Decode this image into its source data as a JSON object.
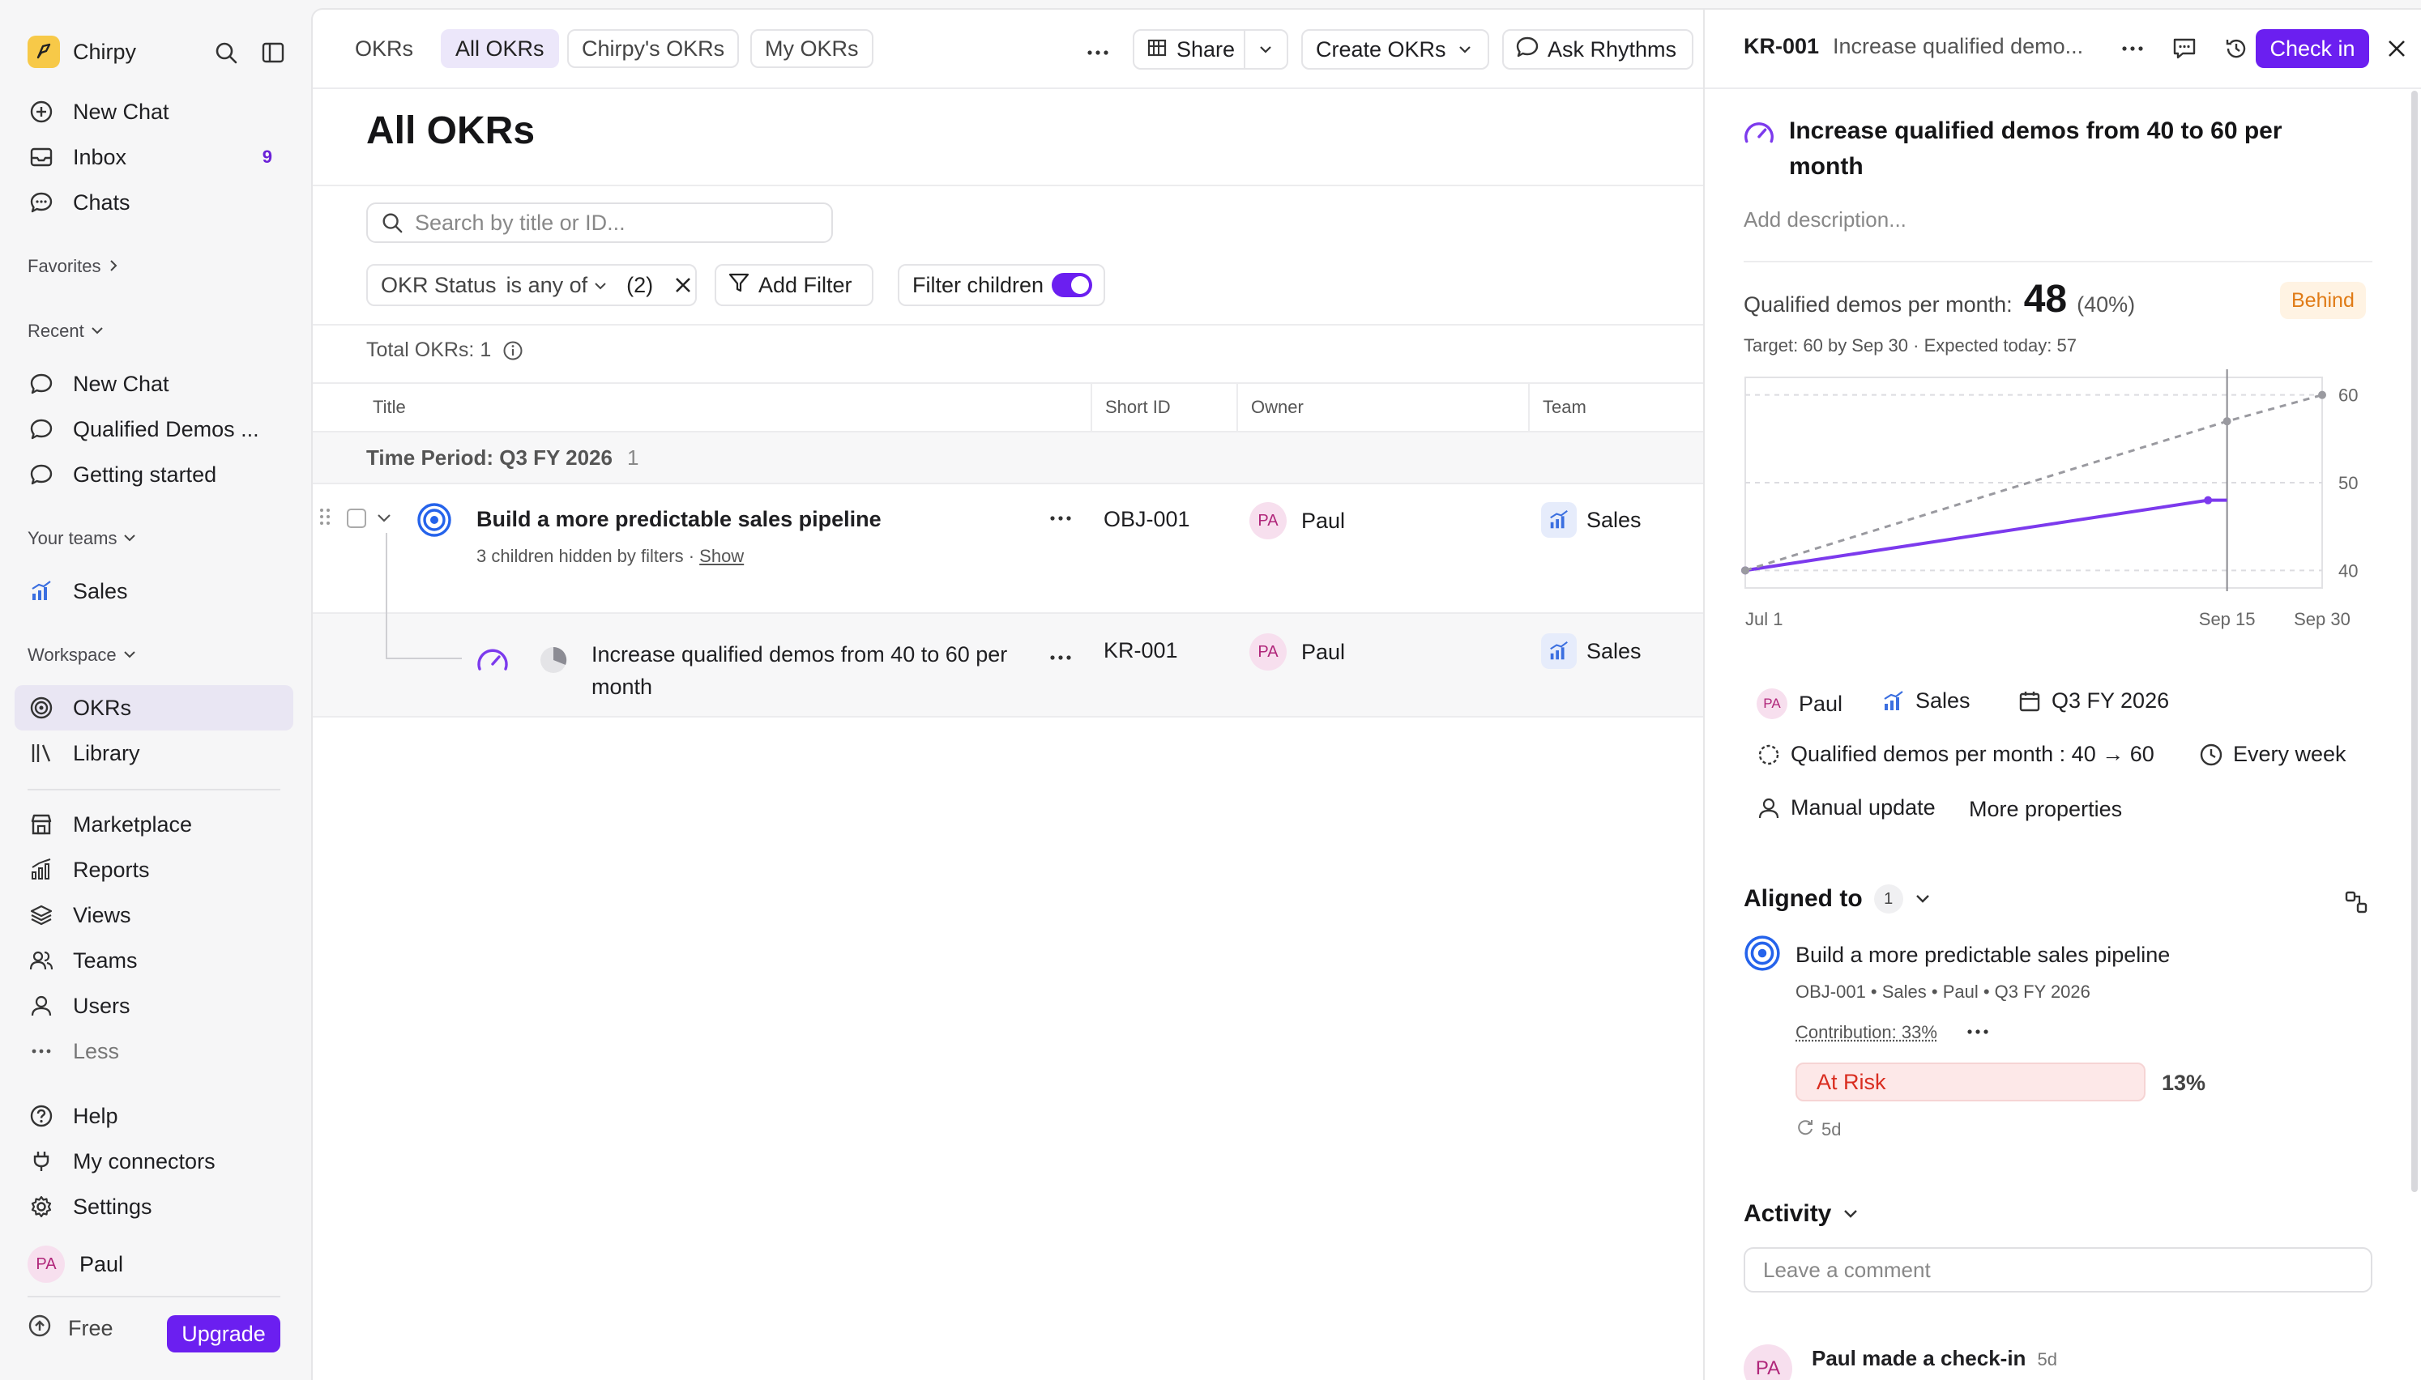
{
  "sidebar": {
    "brand": "Chirpy",
    "nav_top": [
      {
        "label": "New Chat",
        "icon": "plus-circle-icon"
      },
      {
        "label": "Inbox",
        "icon": "inbox-icon",
        "badge": "9"
      },
      {
        "label": "Chats",
        "icon": "chat-bubble-icon"
      }
    ],
    "favorites_label": "Favorites",
    "recent_label": "Recent",
    "recent": [
      {
        "label": "New Chat"
      },
      {
        "label": "Qualified Demos ..."
      },
      {
        "label": "Getting started"
      }
    ],
    "teams_label": "Your teams",
    "teams": [
      {
        "label": "Sales"
      }
    ],
    "workspace_label": "Workspace",
    "workspace": [
      {
        "label": "OKRs",
        "active": true
      },
      {
        "label": "Library"
      }
    ],
    "more": [
      {
        "label": "Marketplace"
      },
      {
        "label": "Reports"
      },
      {
        "label": "Views"
      },
      {
        "label": "Teams"
      },
      {
        "label": "Users"
      },
      {
        "label": "Less"
      }
    ],
    "bottom": [
      {
        "label": "Help"
      },
      {
        "label": "My connectors"
      },
      {
        "label": "Settings"
      }
    ],
    "user": {
      "initials": "PA",
      "name": "Paul"
    },
    "plan": "Free",
    "upgrade": "Upgrade"
  },
  "main": {
    "tabs": [
      "OKRs",
      "All OKRs",
      "Chirpy's OKRs",
      "My OKRs"
    ],
    "share": "Share",
    "create": "Create OKRs",
    "ask": "Ask Rhythms",
    "title": "All OKRs",
    "search_placeholder": "Search by title or ID...",
    "filter": {
      "field": "OKR Status",
      "op": "is any of",
      "count": "(2)"
    },
    "add_filter": "Add Filter",
    "filter_children": "Filter children",
    "total": "Total OKRs: 1",
    "columns": [
      "Title",
      "Short ID",
      "Owner",
      "Team"
    ],
    "group": {
      "label": "Time Period: Q3 FY 2026",
      "count": "1"
    },
    "rows": [
      {
        "title": "Build a more predictable sales pipeline",
        "sub": "3 children hidden by filters",
        "sub_link": "Show",
        "id": "OBJ-001",
        "owner_initials": "PA",
        "owner": "Paul",
        "team": "Sales"
      },
      {
        "title": "Increase qualified demos from 40 to 60 per month",
        "id": "KR-001",
        "owner_initials": "PA",
        "owner": "Paul",
        "team": "Sales"
      }
    ]
  },
  "panel": {
    "key": "KR-001",
    "header_title": "Increase qualified demo...",
    "checkin": "Check in",
    "title": "Increase qualified demos from 40 to 60 per month",
    "add_description": "Add description...",
    "metric_label": "Qualified demos per month:",
    "metric_value": "48",
    "metric_pct": "(40%)",
    "status": "Behind",
    "target": "Target: 60 by Sep 30 · Expected today: 57",
    "props": {
      "owner_initials": "PA",
      "owner": "Paul",
      "team": "Sales",
      "period": "Q3 FY 2026",
      "measure": "Qualified demos per month : 40 → 60",
      "cadence": "Every week",
      "update": "Manual update",
      "more": "More properties"
    },
    "aligned_label": "Aligned to",
    "aligned_count": "1",
    "aligned": {
      "title": "Build a more predictable sales pipeline",
      "meta": "OBJ-001 • Sales • Paul • Q3 FY 2026",
      "contribution": "Contribution: 33%",
      "status": "At Risk",
      "pct": "13%",
      "age": "5d"
    },
    "activity_label": "Activity",
    "comment_placeholder": "Leave a comment",
    "activity_entry": {
      "initials": "PA",
      "text": "Paul made a check-in",
      "age": "5d"
    }
  },
  "chart_data": {
    "type": "line",
    "xlabel": "",
    "ylabel": "",
    "x_ticks": [
      "Jul 1",
      "Sep 15",
      "Sep 30"
    ],
    "y_ticks": [
      40,
      50,
      60
    ],
    "ylim": [
      38,
      62
    ],
    "series": [
      {
        "values_x": [
          "Jul 1",
          "Sep 12",
          "Sep 15"
        ],
        "values_y": [
          40,
          48,
          48
        ],
        "color": "#7c3aed",
        "style": "solid"
      },
      {
        "values_x": [
          "Jul 1",
          "Sep 15",
          "Sep 30"
        ],
        "values_y": [
          40,
          57,
          60
        ],
        "color": "#9a9aa0",
        "style": "dashed"
      }
    ],
    "today_marker": "Sep 15",
    "grid": true
  }
}
